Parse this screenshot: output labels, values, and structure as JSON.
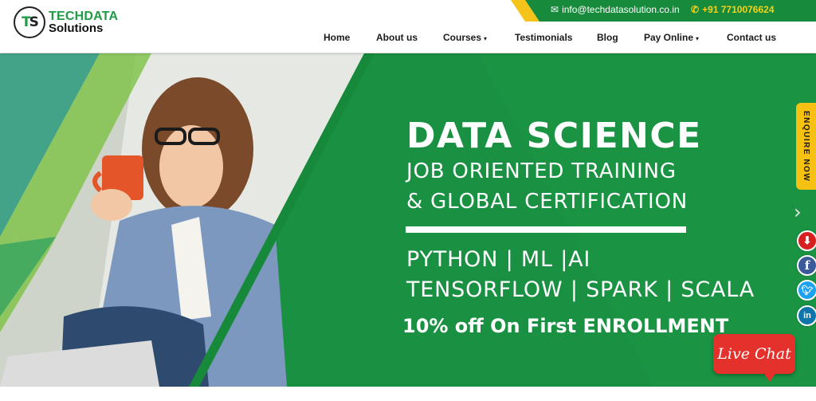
{
  "brand": {
    "logo_initials": "TS",
    "name_line1": "TECHDATA",
    "name_line2": "Solutions"
  },
  "topbar": {
    "email": "info@techdatasolution.co.in",
    "phone": "+91 7710076624",
    "email_icon": "envelope-icon",
    "phone_icon": "phone-icon"
  },
  "nav": {
    "items": [
      {
        "label": "Home",
        "has_dropdown": false
      },
      {
        "label": "About us",
        "has_dropdown": false
      },
      {
        "label": "Courses",
        "has_dropdown": true
      },
      {
        "label": "Testimonials",
        "has_dropdown": false
      },
      {
        "label": "Blog",
        "has_dropdown": false
      },
      {
        "label": "Pay Online",
        "has_dropdown": true
      },
      {
        "label": "Contact us",
        "has_dropdown": false
      }
    ]
  },
  "hero": {
    "headline": "DATA SCIENCE",
    "sub_line1": "JOB ORIENTED TRAINING",
    "sub_line2": "& GLOBAL CERTIFICATION",
    "tech_line1": "PYTHON | ML |AI",
    "tech_line2": "TENSORFLOW | SPARK | SCALA",
    "offer": "10% off On First ENROLLMENT"
  },
  "widgets": {
    "enquire_label": "ENQUIRE NOW",
    "live_chat_label": "Live Chat",
    "next_arrow": "›",
    "social_icons": [
      "download-icon",
      "facebook-icon",
      "twitter-icon",
      "linkedin-icon"
    ]
  },
  "colors": {
    "brand_green": "#1e9c43",
    "hero_green": "#1c8f40",
    "accent_yellow": "#f4c41a",
    "chat_red": "#e4312c"
  }
}
